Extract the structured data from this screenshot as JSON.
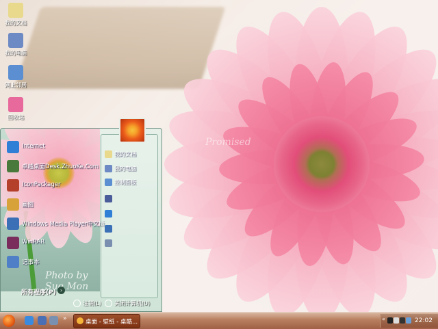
{
  "desktop": {
    "icons": [
      {
        "label": "我的文档",
        "icon": "documents-folder-icon",
        "color": "#e9d98c"
      },
      {
        "label": "我的电脑",
        "icon": "computer-icon",
        "color": "#6d8ac4"
      },
      {
        "label": "网上邻居",
        "icon": "network-icon",
        "color": "#5b8fd1"
      },
      {
        "label": "回收站",
        "icon": "recycle-bin-icon",
        "color": "#e86a9c"
      }
    ],
    "wallpaper_watermark": "Promised"
  },
  "start_menu": {
    "pinned": [
      {
        "label": "Internet",
        "icon": "internet-explorer-icon",
        "color": "#2f7fd6"
      },
      {
        "label": "卓越桌面Desk.ZhuoKe.Com",
        "icon": "zhuoke-desk-icon",
        "color": "#4a7a3b"
      },
      {
        "label": "IconPackager",
        "icon": "iconpackager-icon",
        "color": "#b43f2a"
      },
      {
        "label": "画图",
        "icon": "paint-icon",
        "color": "#d8a23b"
      },
      {
        "label": "Windows Media Player中文版",
        "icon": "media-player-icon",
        "color": "#3b6fb6"
      },
      {
        "label": "WinRAR",
        "icon": "winrar-icon",
        "color": "#7a2c5c"
      },
      {
        "label": "记事本",
        "icon": "notepad-icon",
        "color": "#4f7fc7"
      }
    ],
    "all_programs": "所有程序(P)",
    "photo_signature": "Photo by Sue Mon",
    "right_items": [
      {
        "label": "我的文档",
        "icon": "my-documents-icon",
        "color": "#e9d98c"
      },
      {
        "label": "我的电脑",
        "icon": "my-computer-icon",
        "color": "#6d8ac4"
      },
      {
        "label": "控制面板",
        "icon": "control-panel-icon",
        "color": "#5b8fd1"
      },
      {
        "label": "",
        "icon": "printer-icon",
        "color": "#4a5d9a"
      },
      {
        "label": "",
        "icon": "help-icon",
        "color": "#2f7fd6"
      },
      {
        "label": "",
        "icon": "search-icon",
        "color": "#3b6fb6"
      },
      {
        "label": "",
        "icon": "run-icon",
        "color": "#7a8fb0"
      }
    ],
    "logoff": "注销(L)",
    "shutdown": "关闭计算机(U)"
  },
  "taskbar": {
    "start_icon": "start-orb-icon",
    "quick_launch": [
      {
        "icon": "ie-quicklaunch-icon",
        "color": "#3a8ae0"
      },
      {
        "icon": "media-quicklaunch-icon",
        "color": "#4a6fb4"
      },
      {
        "icon": "desktop-quicklaunch-icon",
        "color": "#7a90b0"
      }
    ],
    "more": "»",
    "task_button": "桌面 - 壁纸 - 桌酷...",
    "tray_expand": "«",
    "tray_icons": [
      {
        "icon": "tray-app-icon-1",
        "color": "#222"
      },
      {
        "icon": "tray-app-icon-2",
        "color": "#ddd"
      },
      {
        "icon": "tray-app-icon-3",
        "color": "#333"
      },
      {
        "icon": "tray-volume-icon",
        "color": "#6aa0d8"
      }
    ],
    "clock": "22:02"
  }
}
